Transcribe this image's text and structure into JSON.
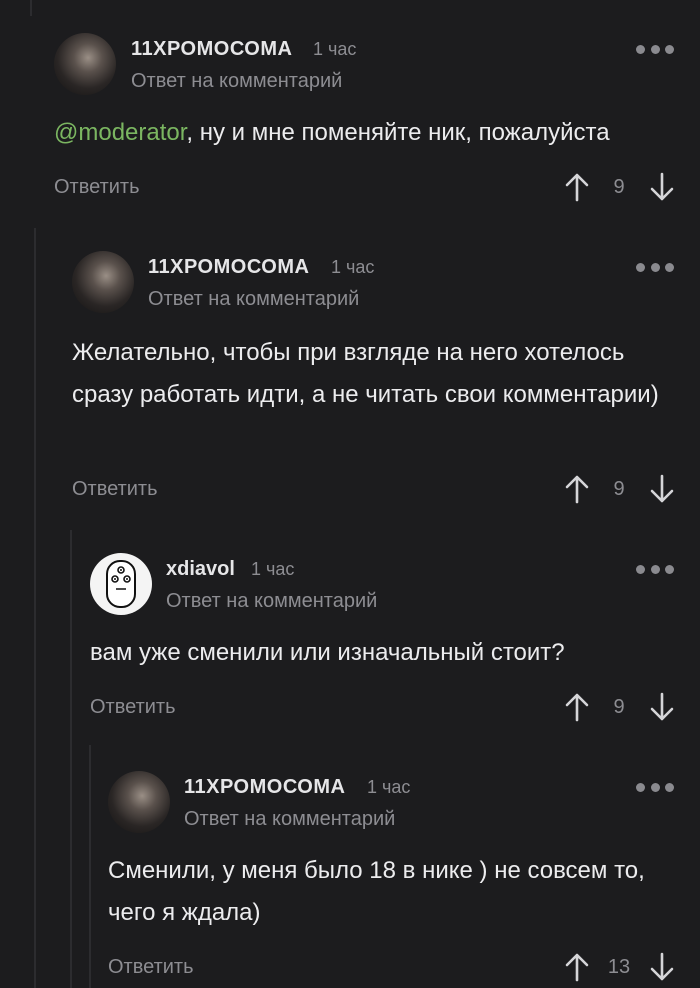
{
  "comments": [
    {
      "username": "11ХРОМОСОМА",
      "time": "1 час",
      "subtitle": "Ответ на комментарий",
      "mention": "@moderator",
      "text": ", ну и мне поменяйте ник, пожалуйста",
      "reply_label": "Ответить",
      "score": "9"
    },
    {
      "username": "11ХРОМОСОМА",
      "time": "1 час",
      "subtitle": "Ответ на комментарий",
      "text": "Желательно, чтобы при взгляде на него хотелось сразу работать идти, а не читать свои комментарии)",
      "reply_label": "Ответить",
      "score": "9"
    },
    {
      "username": "xdiavol",
      "time": "1 час",
      "subtitle": "Ответ на комментарий",
      "text": "вам уже сменили или изначальный стоит?",
      "reply_label": "Ответить",
      "score": "9"
    },
    {
      "username": "11ХРОМОСОМА",
      "time": "1 час",
      "subtitle": "Ответ на комментарий",
      "text": "Сменили, у меня было 18 в нике ) не совсем то, чего я ждала)",
      "reply_label": "Ответить",
      "score": "13"
    }
  ],
  "colors": {
    "background": "#1c1c1e",
    "mention": "#7bb661",
    "muted": "#8d8d92"
  }
}
